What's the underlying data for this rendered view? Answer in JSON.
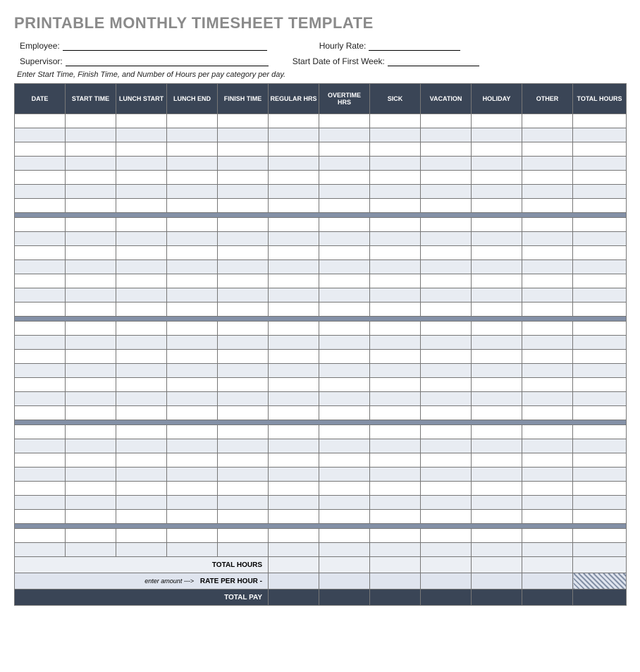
{
  "title": "PRINTABLE MONTHLY TIMESHEET TEMPLATE",
  "meta": {
    "employee_label": "Employee:",
    "hourly_rate_label": "Hourly Rate:",
    "supervisor_label": "Supervisor:",
    "start_date_label": "Start Date of First Week:"
  },
  "instruction": "Enter Start Time, Finish Time, and Number of Hours per pay category per day.",
  "columns": [
    "DATE",
    "START TIME",
    "LUNCH START",
    "LUNCH END",
    "FINISH TIME",
    "REGULAR HRS",
    "OVERTIME HRS",
    "SICK",
    "VACATION",
    "HOLIDAY",
    "OTHER",
    "TOTAL HOURS"
  ],
  "weeks": 4,
  "days_per_week": 7,
  "extra_rows": 2,
  "summary": {
    "total_hours_label": "TOTAL HOURS",
    "enter_amount_hint": "enter amount --->",
    "rate_label": "RATE PER HOUR -",
    "total_pay_label": "TOTAL PAY"
  }
}
